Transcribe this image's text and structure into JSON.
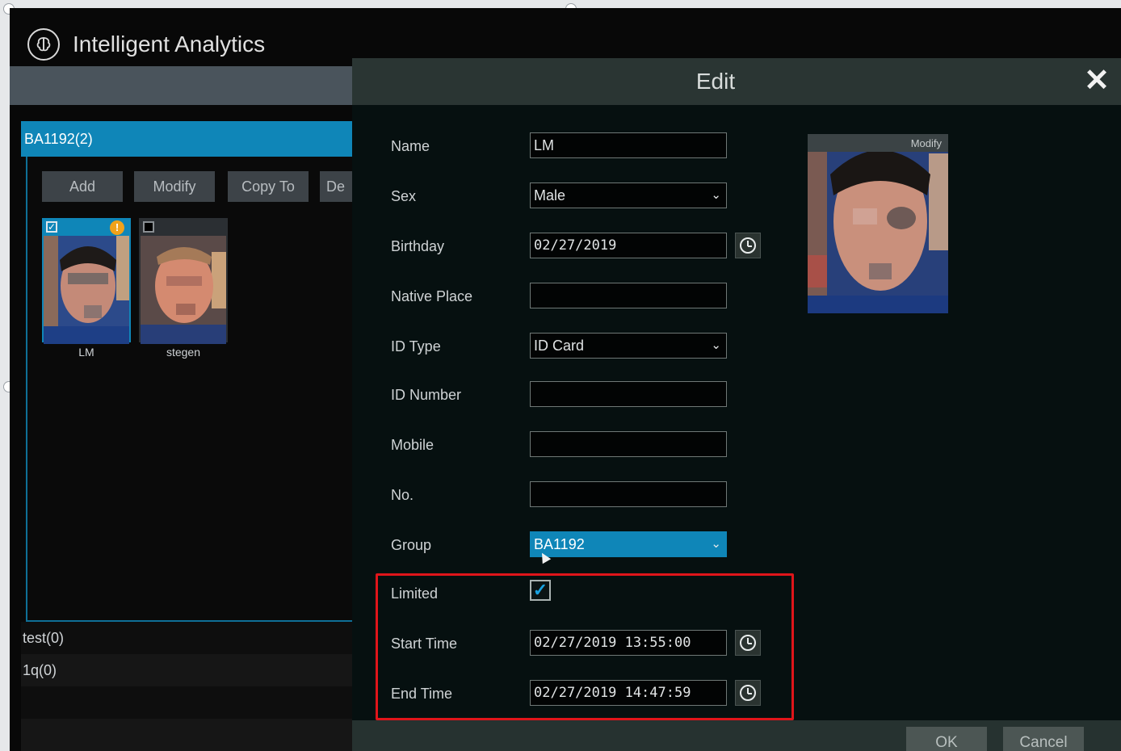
{
  "app": {
    "title": "Intelligent Analytics",
    "logo_icon": "brain-icon"
  },
  "left_panel": {
    "group_header": "BA1192(2)",
    "toolbar": {
      "add_label": "Add",
      "modify_label": "Modify",
      "copy_to_label": "Copy To",
      "delete_label": "De"
    },
    "thumbnails": [
      {
        "label": "LM",
        "checked": true,
        "warning": "!"
      },
      {
        "label": "stegen",
        "checked": false
      }
    ],
    "groups": [
      {
        "label": "test(0)"
      },
      {
        "label": "1q(0)"
      }
    ]
  },
  "dialog": {
    "title": "Edit",
    "close_icon": "close-icon",
    "preview_label": "Modify",
    "fields": {
      "name": {
        "label": "Name",
        "value": "LM"
      },
      "sex": {
        "label": "Sex",
        "value": "Male"
      },
      "birthday": {
        "label": "Birthday",
        "value": "02/27/2019"
      },
      "native_place": {
        "label": "Native Place",
        "value": ""
      },
      "id_type": {
        "label": "ID Type",
        "value": "ID Card"
      },
      "id_number": {
        "label": "ID Number",
        "value": ""
      },
      "mobile": {
        "label": "Mobile",
        "value": ""
      },
      "no": {
        "label": "No.",
        "value": ""
      },
      "group": {
        "label": "Group",
        "value": "BA1192"
      },
      "limited": {
        "label": "Limited",
        "checked": true
      },
      "start_time": {
        "label": "Start Time",
        "value": "02/27/2019 13:55:00"
      },
      "end_time": {
        "label": "End Time",
        "value": "02/27/2019 14:47:59"
      }
    },
    "ok_label": "OK",
    "cancel_label": "Cancel"
  },
  "colors": {
    "accent_blue": "#0f86b8",
    "highlight_red": "#e0151a",
    "warning_orange": "#f0a21b"
  }
}
